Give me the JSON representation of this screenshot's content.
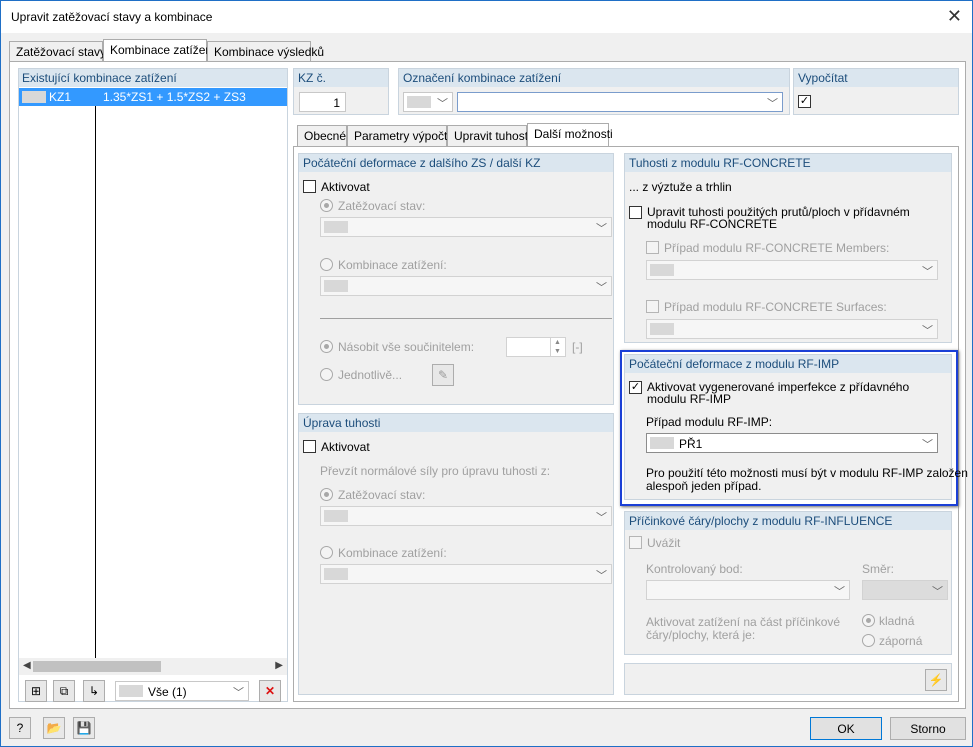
{
  "title": "Upravit zatěžovací stavy a kombinace",
  "top_tabs": [
    "Zatěžovací stavy",
    "Kombinace zatížení",
    "Kombinace výsledků"
  ],
  "left": {
    "header": "Existující kombinace zatížení",
    "rows": [
      {
        "id": "KZ1",
        "formula": "1.35*ZS1 + 1.5*ZS2 + ZS3"
      }
    ],
    "filter_value": "Vše (1)"
  },
  "kz_no": {
    "label": "KZ č.",
    "value": "1"
  },
  "designation": {
    "label": "Označení kombinace zatížení",
    "value": ""
  },
  "calculate": {
    "label": "Vypočítat",
    "checked": true
  },
  "sub_tabs": [
    "Obecné",
    "Parametry výpočtu",
    "Upravit tuhosti",
    "Další možnosti"
  ],
  "init_def": {
    "header": "Počáteční deformace z dalšího ZS / další KZ",
    "activate": "Aktivovat",
    "load_case": "Zatěžovací stav:",
    "load_combo": "Kombinace zatížení:",
    "multiply": "Násobit vše součinitelem:",
    "unit": "[-]",
    "individually": "Jednotlivě..."
  },
  "stiff_mod": {
    "header": "Úprava tuhosti",
    "activate": "Aktivovat",
    "take_normal": "Převzít normálové síly pro úpravu tuhosti z:",
    "load_case": "Zatěžovací stav:",
    "load_combo": "Kombinace zatížení:"
  },
  "rf_concrete": {
    "header": "Tuhosti z modulu RF-CONCRETE",
    "subheader": "... z výztuže a trhlin",
    "adjust_line1": "Upravit tuhosti použitých prutů/ploch v přídavném",
    "adjust_line2": "modulu RF-CONCRETE",
    "members": "Případ modulu RF-CONCRETE Members:",
    "surfaces": "Případ modulu RF-CONCRETE Surfaces:"
  },
  "rf_imp": {
    "header": "Počáteční deformace z modulu RF-IMP",
    "activate_line1": "Aktivovat vygenerované imperfekce z přídavného",
    "activate_line2": "modulu RF-IMP",
    "case_label": "Případ modulu RF-IMP:",
    "case_value": "PŘ1",
    "note_line1": "Pro použití této možnosti musí být v modulu RF-IMP založen",
    "note_line2": "alespoň jeden případ."
  },
  "rf_influence": {
    "header": "Příčinkové čáry/plochy z modulu RF-INFLUENCE",
    "consider": "Uvážit",
    "check_point": "Kontrolovaný bod:",
    "direction": "Směr:",
    "activate_load_line1": "Aktivovat zatížení na část příčinkové",
    "activate_load_line2": "čáry/plochy, která  je:",
    "positive": "kladná",
    "negative": "záporná"
  },
  "ok_label": "OK",
  "cancel_label": "Storno",
  "colors": {
    "highlight": "#3399ff",
    "focus_border": "#1a3fd6",
    "group_header": "#dbe6ef"
  }
}
